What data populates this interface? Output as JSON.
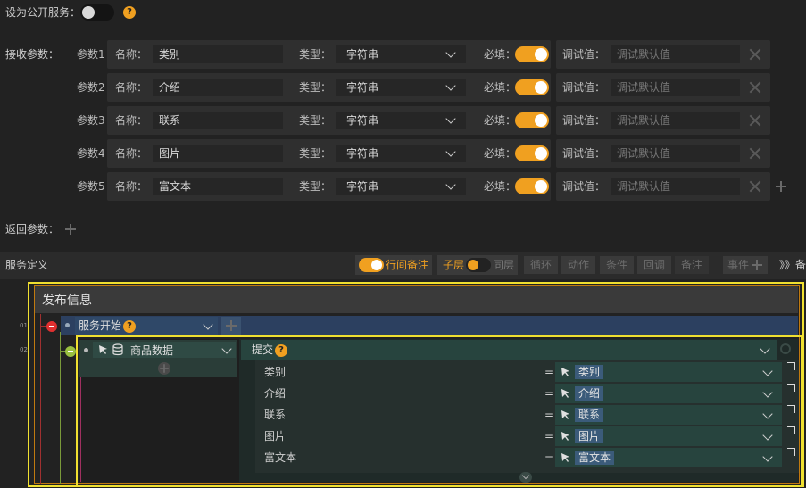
{
  "public_service": {
    "label": "设为公开服务：",
    "enabled": false
  },
  "receive_params": {
    "label": "接收参数：",
    "name_label": "名称：",
    "type_label": "类型：",
    "required_label": "必填：",
    "debug_label": "调试值：",
    "debug_placeholder": "调试默认值",
    "items": [
      {
        "label": "参数1",
        "name": "类别",
        "type": "字符串",
        "required": true
      },
      {
        "label": "参数2",
        "name": "介绍",
        "type": "字符串",
        "required": true
      },
      {
        "label": "参数3",
        "name": "联系",
        "type": "字符串",
        "required": true
      },
      {
        "label": "参数4",
        "name": "图片",
        "type": "字符串",
        "required": true
      },
      {
        "label": "参数5",
        "name": "富文本",
        "type": "字符串",
        "required": true
      }
    ]
  },
  "return_params": {
    "label": "返回参数："
  },
  "service_def": {
    "label": "服务定义",
    "toolbar": {
      "inline_note": "行间备注",
      "child_layer": "子层",
      "same_layer": "同层",
      "loop": "循环",
      "action": "动作",
      "condition": "条件",
      "callback": "回调",
      "note": "备注",
      "event": "事件",
      "more": "》》备"
    }
  },
  "flow": {
    "title": "发布信息",
    "line_numbers": [
      "01",
      "02"
    ],
    "start_node": "服务开始",
    "data_node": "商品数据",
    "submit": "提交",
    "mappings": [
      {
        "field": "类别",
        "eq": "=",
        "value": "类别"
      },
      {
        "field": "介绍",
        "eq": "=",
        "value": "介绍"
      },
      {
        "field": "联系",
        "eq": "=",
        "value": "联系"
      },
      {
        "field": "图片",
        "eq": "=",
        "value": "图片"
      },
      {
        "field": "富文本",
        "eq": "=",
        "value": "富文本"
      }
    ]
  }
}
